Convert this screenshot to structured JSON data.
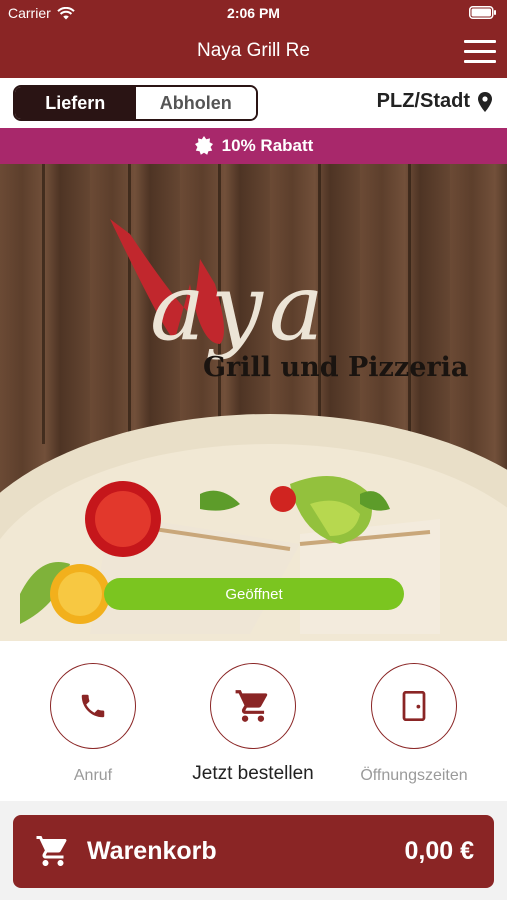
{
  "status_bar": {
    "carrier": "Carrier",
    "time": "2:06 PM"
  },
  "nav": {
    "title": "Naya Grill Re",
    "menu_icon": "hamburger-menu-icon"
  },
  "order_mode": {
    "delivery_label": "Liefern",
    "pickup_label": "Abholen",
    "selected": "Liefern",
    "location_label": "PLZ/Stadt"
  },
  "promo": {
    "text": "10% Rabatt",
    "icon": "badge-icon"
  },
  "hero": {
    "logo_text": "Naya",
    "logo_subtitle": "Grill und Pizzeria",
    "open_status": "Geöffnet"
  },
  "actions": [
    {
      "label": "Anruf",
      "icon": "phone-icon"
    },
    {
      "label": "Jetzt bestellen",
      "icon": "cart-icon"
    },
    {
      "label": "Öffnungszeiten",
      "icon": "door-icon"
    }
  ],
  "cart": {
    "label": "Warenkorb",
    "total": "0,00 €"
  },
  "colors": {
    "brand": "#8a2525",
    "promo": "#a8286b",
    "open": "#7bc520",
    "toggle_dark": "#2a1414"
  }
}
